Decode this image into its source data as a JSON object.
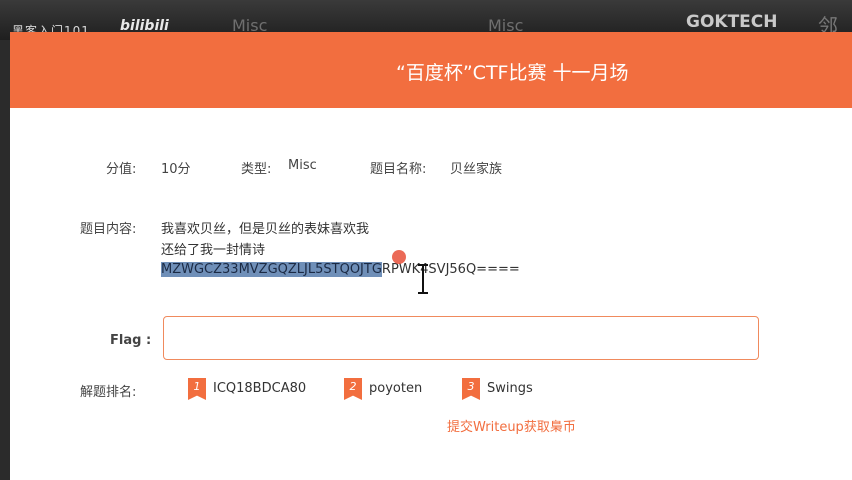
{
  "watermark": {
    "left_text": "黑客入门101",
    "logo_text": "bilibili",
    "tab_text": "Misc",
    "right_text": "GOKTECH",
    "right_glyph": "邻"
  },
  "header": {
    "title": "“百度杯”CTF比赛 十一月场",
    "bg_color": "#f26e3f"
  },
  "meta": {
    "score_label": "分值:",
    "score_value": "10分",
    "type_label": "类型:",
    "type_value": "Misc",
    "name_label": "题目名称:",
    "name_value": "贝丝家族"
  },
  "content": {
    "label": "题目内容:",
    "line1": "我喜欢贝丝，但是贝丝的表妹喜欢我",
    "line2": "还给了我一封情诗",
    "cipher_selected": "MZWGCZ33MVZGQZLJL5STQOJTG",
    "cipher_rest": "RPWK4SVJ56Q===="
  },
  "flag": {
    "label": "Flag",
    "colon": ":",
    "value": "",
    "placeholder": ""
  },
  "ranking": {
    "label": "解题排名:",
    "items": [
      {
        "rank": "1",
        "name": "ICQ18BDCA80"
      },
      {
        "rank": "2",
        "name": "poyoten"
      },
      {
        "rank": "3",
        "name": "Swings"
      }
    ]
  },
  "writeup": {
    "link_text": "提交Writeup获取梟币"
  }
}
